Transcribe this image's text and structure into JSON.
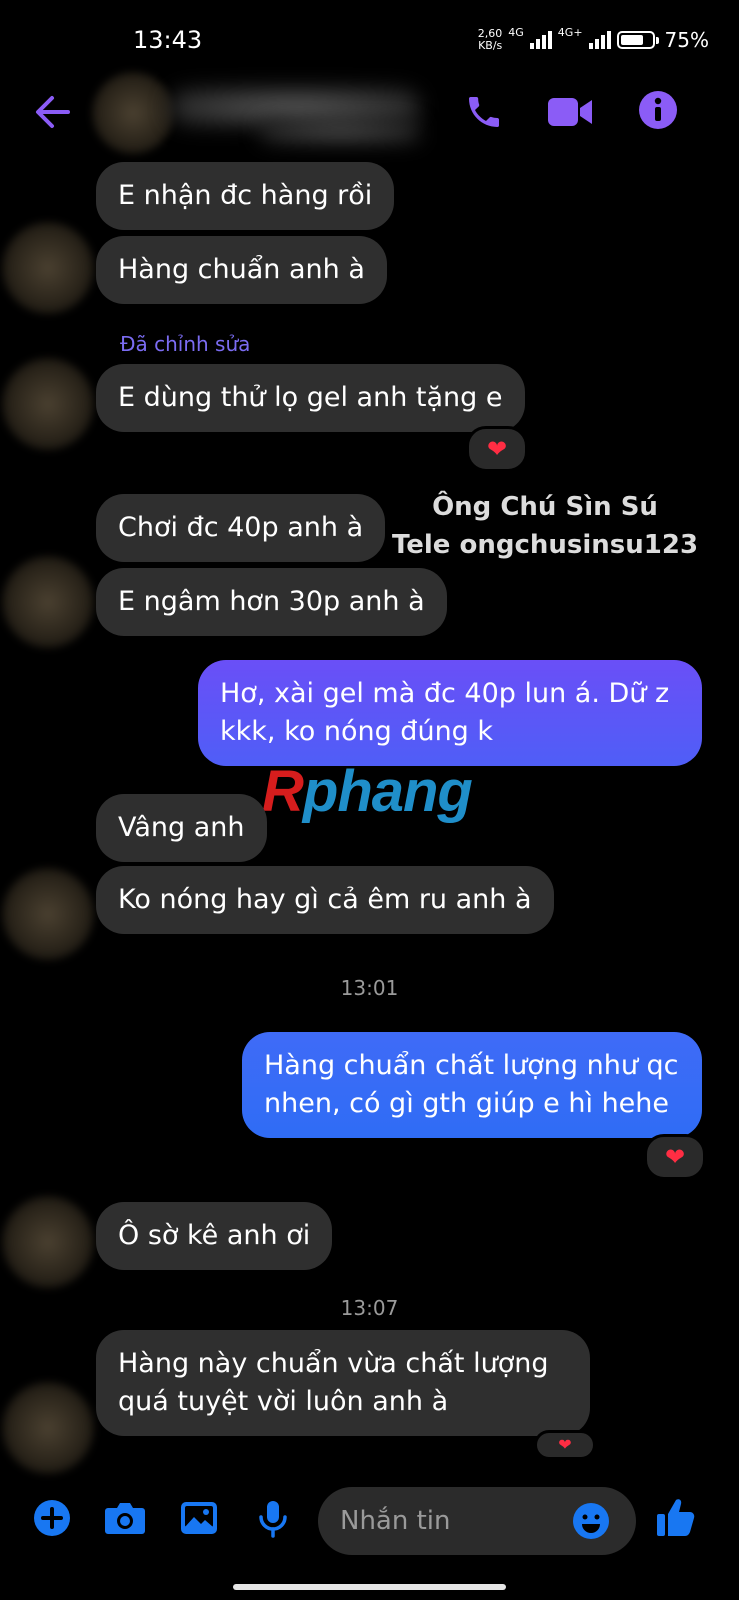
{
  "status_bar": {
    "time": "13:43",
    "net_speed_value": "2,60",
    "net_speed_unit": "KB/s",
    "signal1": "4G",
    "signal2": "4G+",
    "battery": "75%",
    "battery_level": 0.75
  },
  "header": {
    "back_icon": "arrow-left-icon",
    "call_icon": "phone-icon",
    "video_icon": "video-camera-icon",
    "info_icon": "info-icon",
    "accent_color": "#8b5cf6"
  },
  "messages": {
    "m1": "E nhận đc hàng rồi",
    "m2": "Hàng chuẩn anh à",
    "edited_label": "Đã chỉnh sửa",
    "m3": "E dùng thử lọ gel anh tặng e",
    "m4": "Chơi đc 40p anh à",
    "m5": "E ngâm hơn 30p anh à",
    "m6": "Hơ, xài gel mà đc 40p lun á. Dữ z kkk, ko nóng đúng k",
    "m7": "Vâng anh",
    "m8": "Ko nóng hay gì cả êm ru anh à",
    "time1": "13:01",
    "m9": "Hàng chuẩn chất lượng như qc nhen, có gì gth giúp e hì hehe",
    "m10": "Ô sờ kê anh ơi",
    "time2": "13:07",
    "m11": "Hàng này chuẩn vừa chất lượng quá tuyệt vời luôn anh à",
    "reaction": "❤"
  },
  "watermark": {
    "line1": "Ông Chú Sìn Sú",
    "line2": "Tele ongchusinsu123",
    "logo_r": "R",
    "logo_rest": "phang"
  },
  "composer": {
    "placeholder": "Nhắn tin",
    "icons": [
      "plus-icon",
      "camera-icon",
      "image-icon",
      "microphone-icon",
      "emoji-icon",
      "thumbs-up-icon"
    ],
    "accent_color": "#1877f2"
  }
}
